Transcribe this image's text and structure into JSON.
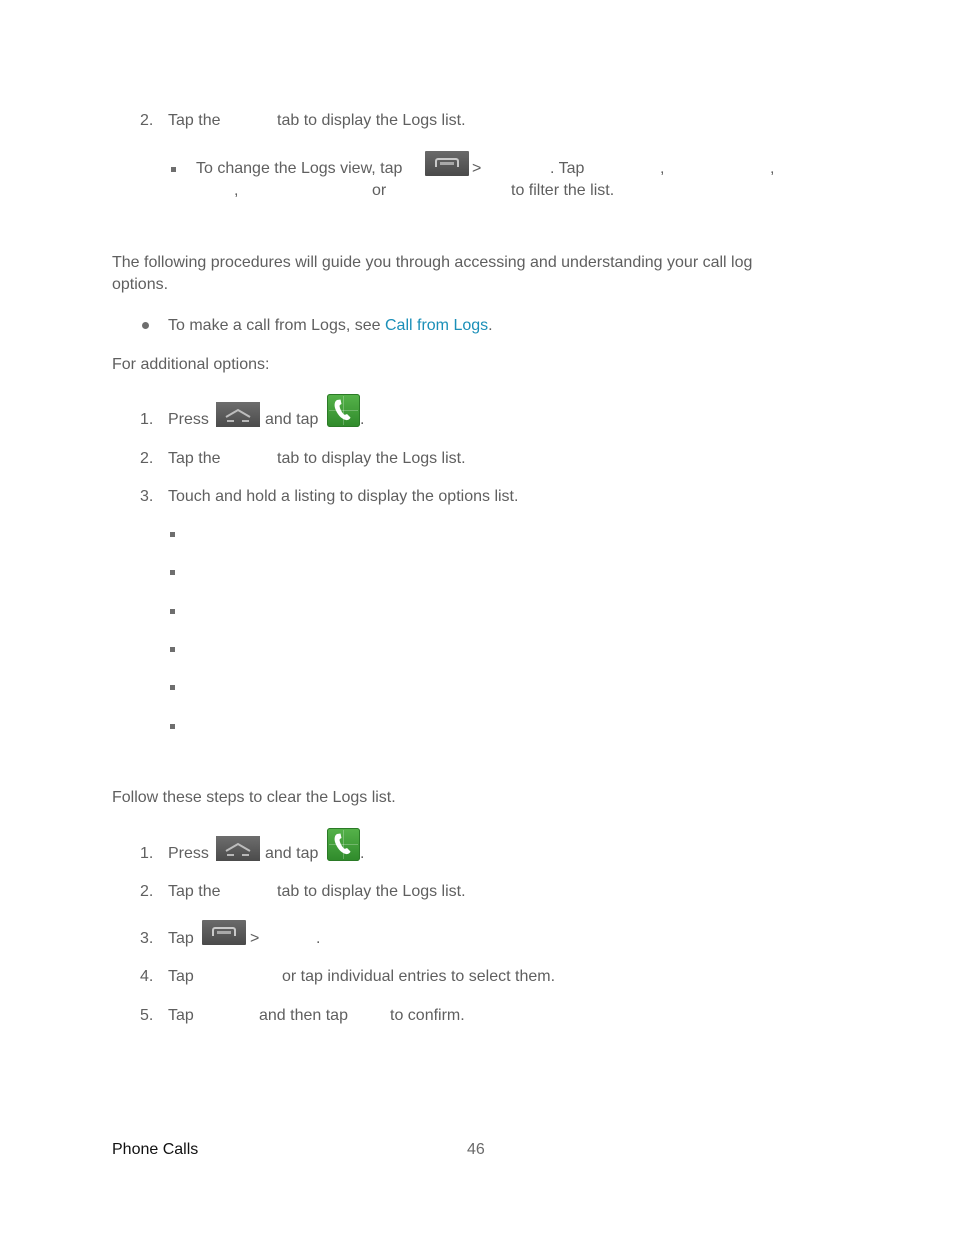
{
  "section1": {
    "step2": {
      "number": "2.",
      "prefix": "Tap the",
      "suffix": "tab to display the Logs list."
    },
    "subbullet": {
      "text_a": "To change the Logs view, tap",
      "gt": ">",
      "text_b": ". Tap",
      "comma1": ",",
      "comma2": ",",
      "comma3": ",",
      "or": "or",
      "text_c": "to filter the list.",
      "icon": "menu-key-icon"
    }
  },
  "section2": {
    "intro_line1": "The following procedures will guide you through accessing and understanding your call log",
    "intro_line2": "options.",
    "bullet": {
      "text": "To make a call from Logs, see",
      "link": "Call from Logs",
      "end": "."
    },
    "additional": "For additional options:",
    "steps": [
      {
        "number": "1.",
        "text_a": "Press",
        "text_b": "and tap",
        "end": ".",
        "icons": [
          "home-key-icon",
          "phone-app-icon"
        ]
      },
      {
        "number": "2.",
        "prefix": "Tap the",
        "suffix": "tab to display the Logs list."
      },
      {
        "number": "3.",
        "text": "Touch and hold a listing to display the options list."
      }
    ],
    "option_bullets_count": 6
  },
  "section3": {
    "intro": "Follow these steps to clear the Logs list.",
    "steps": [
      {
        "number": "1.",
        "text_a": "Press",
        "text_b": "and tap",
        "end": "."
      },
      {
        "number": "2.",
        "prefix": "Tap the",
        "suffix": "tab to display the Logs list."
      },
      {
        "number": "3.",
        "text_a": "Tap",
        "gt": ">",
        "end": "."
      },
      {
        "number": "4.",
        "text_a": "Tap",
        "text_b": "or tap individual entries to select them."
      },
      {
        "number": "5.",
        "text_a": "Tap",
        "text_b": "and then tap",
        "text_c": "to confirm."
      }
    ]
  },
  "footer": {
    "section_name": "Phone Calls",
    "page_number": "46"
  },
  "colors": {
    "body_text": "#5f5f5f",
    "link": "#1a8fb8",
    "footer_text": "#111111"
  }
}
